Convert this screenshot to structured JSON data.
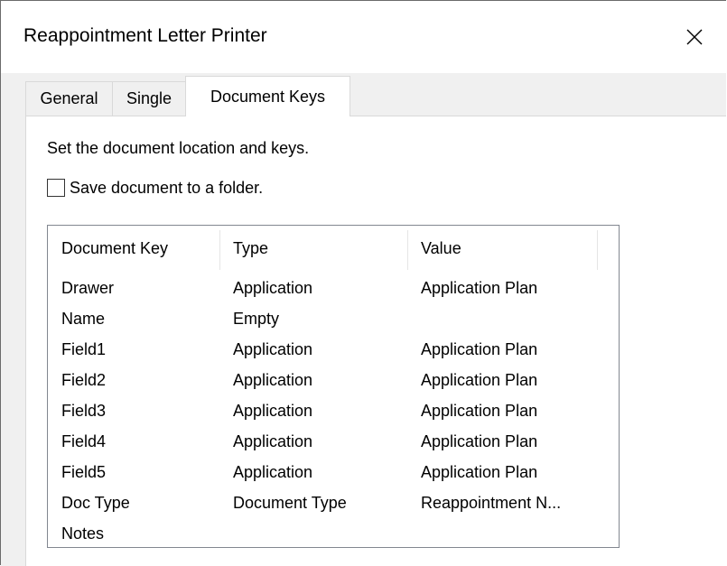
{
  "window": {
    "title": "Reappointment Letter Printer"
  },
  "tabs": [
    {
      "label": "General",
      "active": false
    },
    {
      "label": "Single",
      "active": false
    },
    {
      "label": "Document Keys",
      "active": true
    }
  ],
  "panel": {
    "description": "Set the document location and keys.",
    "save_checkbox": {
      "label": "Save document to a folder.",
      "checked": false
    }
  },
  "list": {
    "columns": [
      "Document Key",
      "Type",
      "Value"
    ],
    "rows": [
      {
        "key": "Drawer",
        "type": "Application",
        "value": "Application Plan"
      },
      {
        "key": "Name",
        "type": "Empty",
        "value": ""
      },
      {
        "key": "Field1",
        "type": "Application",
        "value": "Application Plan"
      },
      {
        "key": "Field2",
        "type": "Application",
        "value": "Application Plan"
      },
      {
        "key": "Field3",
        "type": "Application",
        "value": "Application Plan"
      },
      {
        "key": "Field4",
        "type": "Application",
        "value": "Application Plan"
      },
      {
        "key": "Field5",
        "type": "Application",
        "value": "Application Plan"
      },
      {
        "key": "Doc Type",
        "type": "Document Type",
        "value": "Reappointment N..."
      },
      {
        "key": "Notes",
        "type": "",
        "value": ""
      }
    ]
  },
  "icons": {
    "close": "close-icon"
  }
}
